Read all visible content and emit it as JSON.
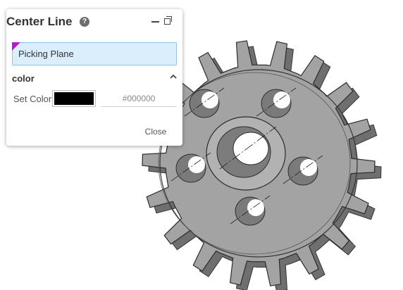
{
  "panel": {
    "title": "Center Line",
    "help_icon": "?",
    "picking": {
      "label": "Picking Plane"
    },
    "color_section": {
      "title": "color",
      "set_color_label": "Set Color",
      "color_value": "#000000",
      "hex_value": "#000000"
    },
    "close_label": "Close"
  },
  "colors": {
    "accent_marker": "#b11ad8",
    "gear_face": "#a3a3a3",
    "gear_side": "#6f6f6f",
    "pick_field_bg": "#dbeefc"
  },
  "icons": [
    "help-icon",
    "minimize-icon",
    "restore-icon",
    "chevron-up-icon"
  ]
}
